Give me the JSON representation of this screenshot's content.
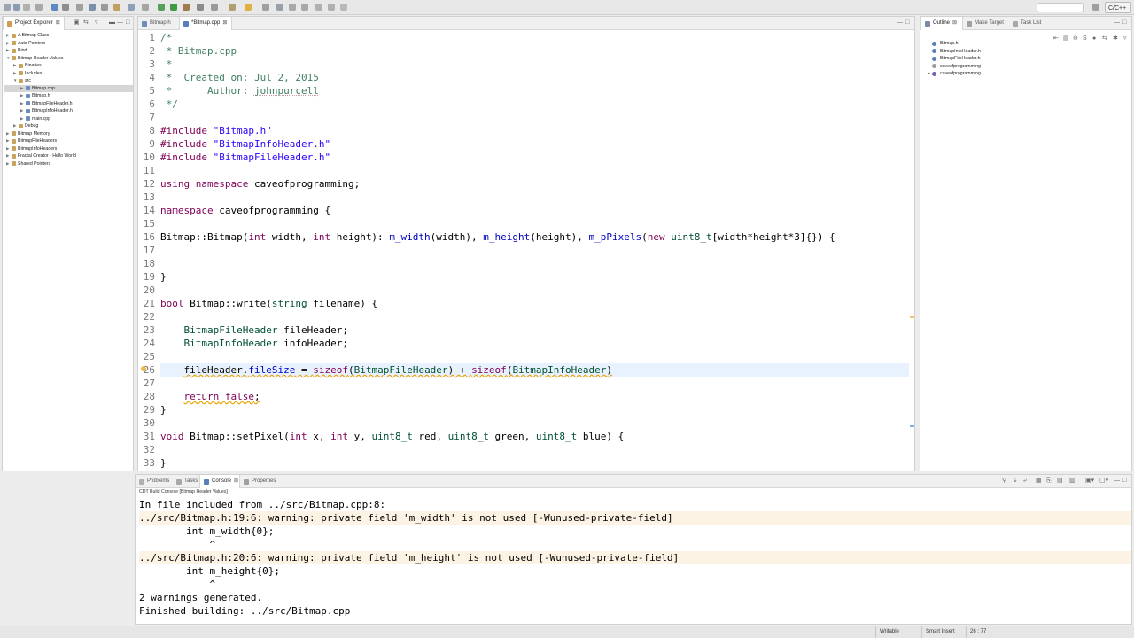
{
  "toolbar": {
    "perspective": "C/C++"
  },
  "project_explorer": {
    "tab_label": "Project Explorer",
    "items": [
      {
        "label": "A Bitmap Class",
        "depth": 0,
        "expanded": false
      },
      {
        "label": "Auto Pointers",
        "depth": 0,
        "expanded": false
      },
      {
        "label": "Bind",
        "depth": 0,
        "expanded": false
      },
      {
        "label": "Bitmap Header Values",
        "depth": 0,
        "expanded": true
      },
      {
        "label": "Binaries",
        "depth": 1,
        "expanded": false
      },
      {
        "label": "Includes",
        "depth": 1,
        "expanded": false
      },
      {
        "label": "src",
        "depth": 1,
        "expanded": true
      },
      {
        "label": "Bitmap.cpp",
        "depth": 2,
        "expanded": false,
        "selected": true
      },
      {
        "label": "Bitmap.h",
        "depth": 2,
        "expanded": false
      },
      {
        "label": "BitmapFileHeader.h",
        "depth": 2,
        "expanded": false
      },
      {
        "label": "BitmapInfoHeader.h",
        "depth": 2,
        "expanded": false
      },
      {
        "label": "main.cpp",
        "depth": 2,
        "expanded": false
      },
      {
        "label": "Debug",
        "depth": 1,
        "expanded": false
      },
      {
        "label": "Bitmap Memory",
        "depth": 0,
        "expanded": false
      },
      {
        "label": "BitmapFileHeaders",
        "depth": 0,
        "expanded": false
      },
      {
        "label": "BitmapInfoHeaders",
        "depth": 0,
        "expanded": false
      },
      {
        "label": "Fractal Creator - Hello World",
        "depth": 0,
        "expanded": false
      },
      {
        "label": "Shared Pointers",
        "depth": 0,
        "expanded": false
      }
    ]
  },
  "editor": {
    "tabs": [
      {
        "label": "Bitmap.h",
        "active": false
      },
      {
        "label": "*Bitmap.cpp",
        "active": true
      }
    ],
    "current_line": 26,
    "lines": [
      {
        "n": "1",
        "html": "<span class=\"cm\">/*</span>"
      },
      {
        "n": "2",
        "html": "<span class=\"cm\"> * Bitmap.cpp</span>"
      },
      {
        "n": "3",
        "html": "<span class=\"cm\"> *</span>"
      },
      {
        "n": "4",
        "html": "<span class=\"cm\"> *  Created on: <span style=\"text-decoration:underline dotted #c9a\">Jul 2, 2015</span></span>"
      },
      {
        "n": "5",
        "html": "<span class=\"cm\"> *      Author: <span style=\"text-decoration:underline dotted #c9a\">johnpurcell</span></span>"
      },
      {
        "n": "6",
        "html": "<span class=\"cm\"> */</span>"
      },
      {
        "n": "7",
        "html": ""
      },
      {
        "n": "8",
        "html": "<span class=\"kw\">#include</span> <span class=\"str\">\"Bitmap.h\"</span>"
      },
      {
        "n": "9",
        "html": "<span class=\"kw\">#include</span> <span class=\"str\">\"BitmapInfoHeader.h\"</span>"
      },
      {
        "n": "10",
        "html": "<span class=\"kw\">#include</span> <span class=\"str\">\"BitmapFileHeader.h\"</span>"
      },
      {
        "n": "11",
        "html": ""
      },
      {
        "n": "12",
        "html": "<span class=\"kw\">using</span> <span class=\"kw\">namespace</span> caveofprogramming;"
      },
      {
        "n": "13",
        "html": ""
      },
      {
        "n": "14",
        "html": "<span class=\"kw\">namespace</span> caveofprogramming {"
      },
      {
        "n": "15",
        "html": ""
      },
      {
        "n": "16",
        "html": "Bitmap::Bitmap(<span class=\"kw\">int</span> width, <span class=\"kw\">int</span> height): <span class=\"fld\">m_width</span>(width), <span class=\"fld\">m_height</span>(height), <span class=\"fld\">m_pPixels</span>(<span class=\"kw\">new</span> <span class=\"ty\">uint8_t</span>[width*height*3]{}) {"
      },
      {
        "n": "17",
        "html": ""
      },
      {
        "n": "18",
        "html": ""
      },
      {
        "n": "19",
        "html": "}"
      },
      {
        "n": "20",
        "html": ""
      },
      {
        "n": "21",
        "html": "<span class=\"kw\">bool</span> Bitmap::write(<span class=\"ty\">string</span> filename) {"
      },
      {
        "n": "22",
        "html": ""
      },
      {
        "n": "23",
        "html": "    <span class=\"ty\">BitmapFileHeader</span> fileHeader;"
      },
      {
        "n": "24",
        "html": "    <span class=\"ty\">BitmapInfoHeader</span> infoHeader;"
      },
      {
        "n": "25",
        "html": ""
      },
      {
        "n": "26",
        "html": "    <span class=\"warn-ul\">fileHeader.<span class=\"fld\">fileSize</span> = <span class=\"kw\">sizeof</span>(<span class=\"ty\">BitmapFileHeader</span>) + <span class=\"kw\">sizeof</span>(<span class=\"ty\">BitmapInfoHeader</span>)</span>"
      },
      {
        "n": "27",
        "html": ""
      },
      {
        "n": "28",
        "html": "    <span class=\"warn-ul\"><span class=\"kw\">return</span> <span class=\"kw\">false</span>;</span>"
      },
      {
        "n": "29",
        "html": "}"
      },
      {
        "n": "30",
        "html": ""
      },
      {
        "n": "31",
        "html": "<span class=\"kw\">void</span> Bitmap::setPixel(<span class=\"kw\">int</span> x, <span class=\"kw\">int</span> y, <span class=\"ty\">uint8_t</span> red, <span class=\"ty\">uint8_t</span> green, <span class=\"ty\">uint8_t</span> blue) {"
      },
      {
        "n": "32",
        "html": ""
      },
      {
        "n": "33",
        "html": "}"
      }
    ]
  },
  "outline": {
    "tabs": [
      {
        "label": "Outline",
        "active": true
      },
      {
        "label": "Make Target",
        "active": false
      },
      {
        "label": "Task List",
        "active": false
      }
    ],
    "items": [
      {
        "label": "Bitmap.h",
        "icon_color": "#5a7fb8",
        "arrow": ""
      },
      {
        "label": "BitmapInfoHeader.h",
        "icon_color": "#5a7fb8",
        "arrow": ""
      },
      {
        "label": "BitmapFileHeader.h",
        "icon_color": "#5a7fb8",
        "arrow": ""
      },
      {
        "label": "caveofprogramming",
        "icon_color": "#9a9a9a",
        "arrow": ""
      },
      {
        "label": "caveofprogramming",
        "icon_color": "#7a5fb0",
        "arrow": "▶"
      }
    ]
  },
  "console": {
    "tabs": [
      {
        "label": "Problems",
        "active": false
      },
      {
        "label": "Tasks",
        "active": false
      },
      {
        "label": "Console",
        "active": true
      },
      {
        "label": "Properties",
        "active": false
      }
    ],
    "header": "CDT Build Console [Bitmap Header Values]",
    "lines": [
      {
        "text": "In file included from ../src/Bitmap.cpp:8:",
        "warning": false
      },
      {
        "text": "../src/Bitmap.h:19:6: warning: private field 'm_width' is not used [-Wunused-private-field]",
        "warning": true
      },
      {
        "text": "        int m_width{0};",
        "warning": false
      },
      {
        "text": "            ^",
        "warning": false
      },
      {
        "text": "../src/Bitmap.h:20:6: warning: private field 'm_height' is not used [-Wunused-private-field]",
        "warning": true
      },
      {
        "text": "        int m_height{0};",
        "warning": false
      },
      {
        "text": "            ^",
        "warning": false
      },
      {
        "text": "2 warnings generated.",
        "warning": false
      },
      {
        "text": "Finished building: ../src/Bitmap.cpp",
        "warning": false
      }
    ]
  },
  "status": {
    "writable": "Writable",
    "insert_mode": "Smart Insert",
    "position": "26 : 77"
  }
}
